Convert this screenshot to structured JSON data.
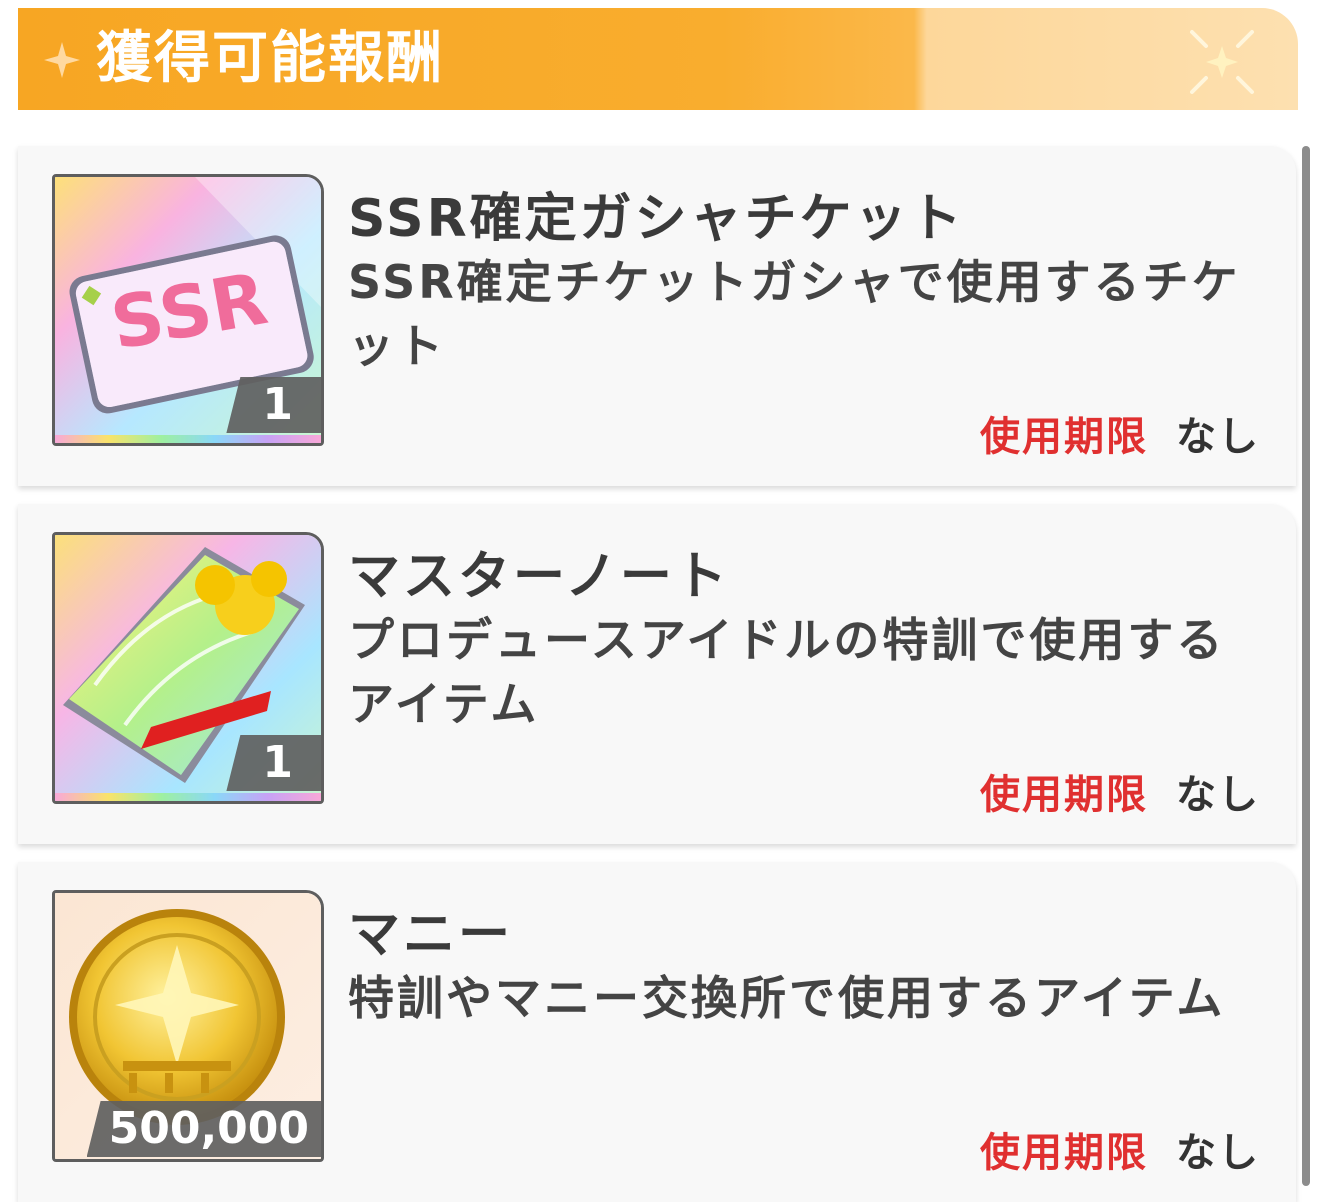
{
  "header": {
    "title": "獲得可能報酬"
  },
  "items": [
    {
      "name": "SSR確定ガシャチケット",
      "description": "SSR確定チケットガシャで使用するチケット",
      "quantity": "1",
      "expiry_label": "使用期限",
      "expiry_value": "なし",
      "icon_text": "SSR",
      "icon": "ssr-ticket-icon"
    },
    {
      "name": "マスターノート",
      "description": "プロデュースアイドルの特訓で使用するアイテム",
      "quantity": "1",
      "expiry_label": "使用期限",
      "expiry_value": "なし",
      "icon": "master-note-icon"
    },
    {
      "name": "マニー",
      "description": "特訓やマニー交換所で使用するアイテム",
      "quantity": "500,000",
      "expiry_label": "使用期限",
      "expiry_value": "なし",
      "icon": "money-coin-icon"
    }
  ],
  "colors": {
    "header": "#f7a623",
    "expiry_label": "#e03030"
  }
}
